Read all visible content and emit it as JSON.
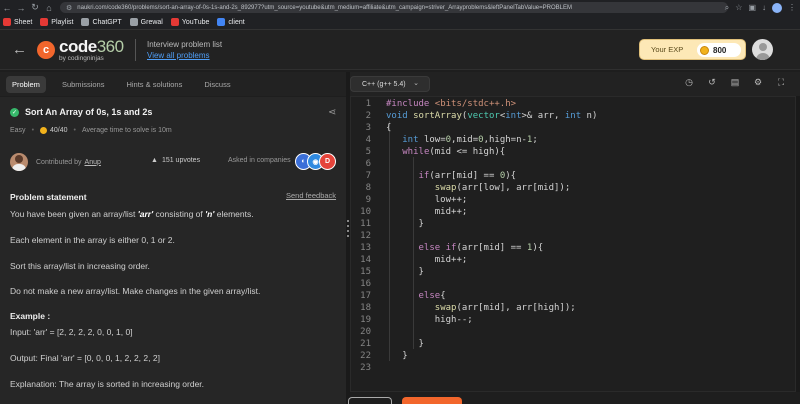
{
  "browser": {
    "url": "naukri.com/code360/problems/sort-an-array-of-0s-1s-and-2s_892977?utm_source=youtube&utm_medium=affiliate&utm_campaign=striver_Arrayproblems&leftPanelTabValue=PROBLEM",
    "bookmarks": [
      {
        "label": "Sheet",
        "color": "#e53935"
      },
      {
        "label": "Playlist",
        "color": "#e53935"
      },
      {
        "label": "ChatGPT",
        "color": "#9aa0a6"
      },
      {
        "label": "Grewal",
        "color": "#9aa0a6"
      },
      {
        "label": "YouTube",
        "color": "#e53935"
      },
      {
        "label": "client",
        "color": "#4285f4"
      }
    ]
  },
  "header": {
    "logo_main": "code",
    "logo_num": "360",
    "logo_sub": "by codingninjas",
    "il_title": "Interview problem list",
    "il_link": "View all problems",
    "exp_label": "Your EXP",
    "exp_value": "800"
  },
  "left": {
    "tabs": [
      "Problem",
      "Submissions",
      "Hints & solutions",
      "Discuss"
    ],
    "title": "Sort An Array of 0s, 1s and 2s",
    "difficulty": "Easy",
    "points": "40/40",
    "avg_time": "Average time to solve is 10m",
    "contributed_by": "Contributed by",
    "contributor": "Anup",
    "upvotes": "151 upvotes",
    "asked_in": "Asked in companies",
    "ps_head": "Problem statement",
    "feedback": "Send feedback",
    "ex_head": "Example :"
  },
  "editor": {
    "language": "C++ (g++ 5.4)"
  },
  "colors": {
    "accent": "#f2662c",
    "link": "#4f9ef6",
    "easy_check": "#37b86b"
  }
}
